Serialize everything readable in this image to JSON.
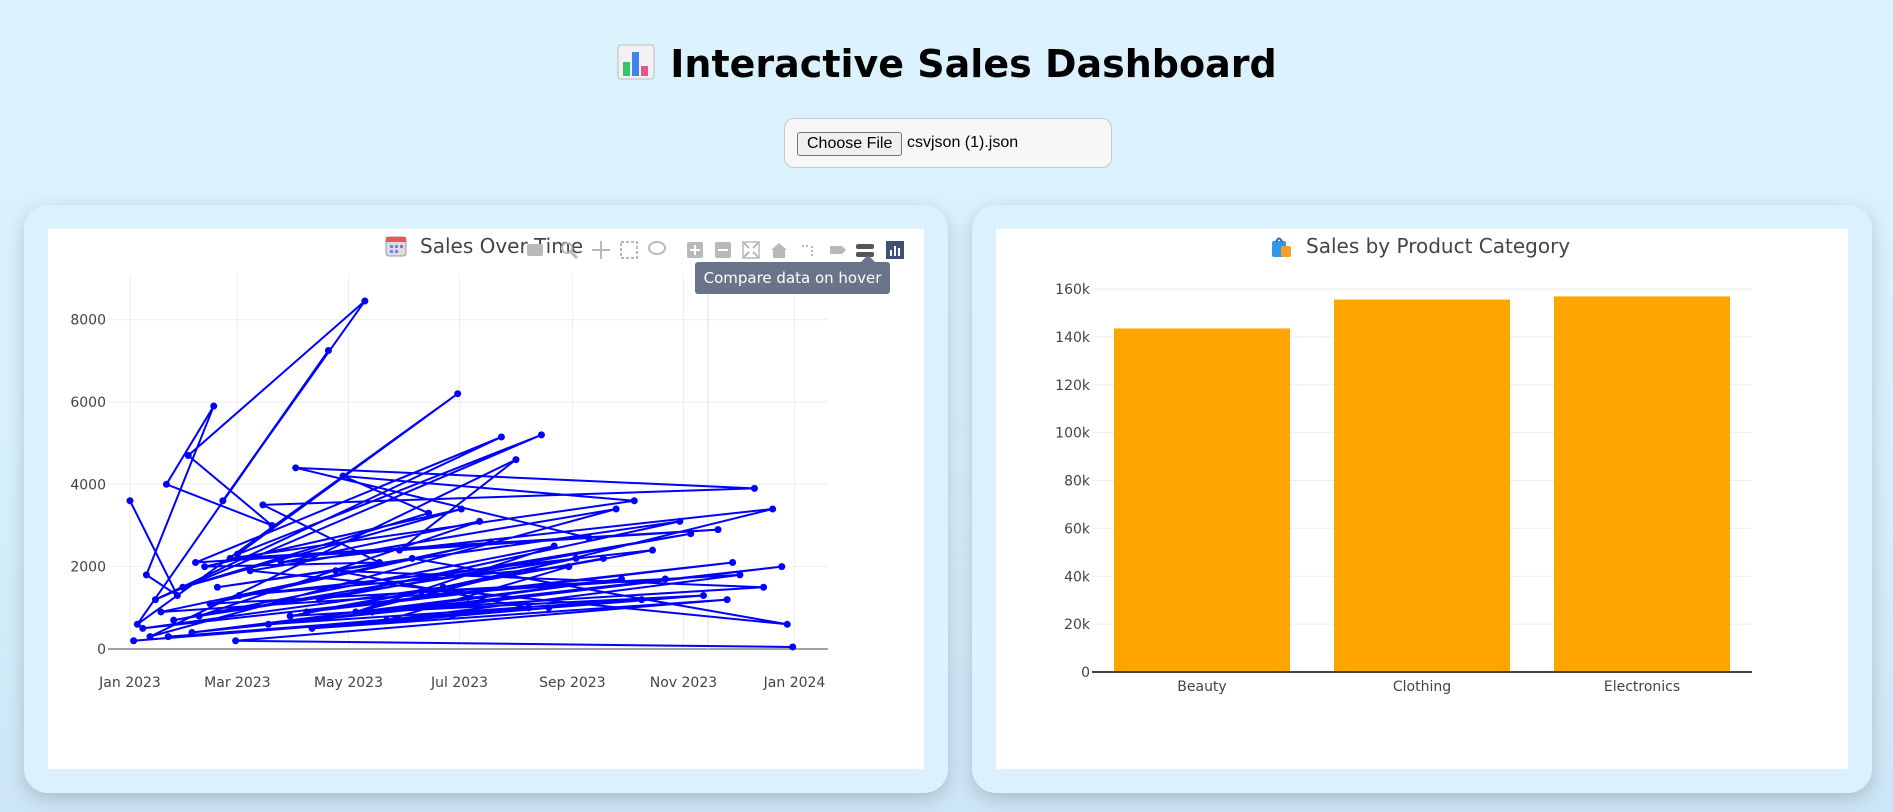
{
  "header": {
    "icon": "bar-chart-emoji-icon",
    "title": "Interactive Sales Dashboard"
  },
  "file_input": {
    "button_label": "Choose File",
    "file_name": "csvjson (1).json"
  },
  "toolbar": {
    "icons": [
      "camera-icon",
      "zoom-icon",
      "pan-icon",
      "box-select-icon",
      "lasso-select-icon",
      "zoom-in-icon",
      "zoom-out-icon",
      "autoscale-icon",
      "reset-axes-icon",
      "spike-lines-icon",
      "hover-closest-icon",
      "hover-compare-icon",
      "plotly-logo-icon"
    ],
    "tooltip": "Compare data on hover"
  },
  "chart_data": [
    {
      "type": "line",
      "title": "Sales Over Time",
      "title_icon": "calendar-emoji-icon",
      "xlabel": "",
      "ylabel": "",
      "x_ticks": [
        "Jan 2023",
        "Mar 2023",
        "May 2023",
        "Jul 2023",
        "Sep 2023",
        "Nov 2023",
        "Jan 2024"
      ],
      "y_ticks": [
        "0",
        "2000",
        "4000",
        "6000",
        "8000"
      ],
      "ylim": [
        0,
        9000
      ],
      "xlim": [
        "2023-01-01",
        "2024-01-15"
      ],
      "grid": true,
      "color": "#0000ff",
      "series": [
        {
          "x": [
            "2023-01-01",
            "2023-01-27",
            "2023-01-10",
            "2023-02-16",
            "2023-01-21",
            "2023-03-20",
            "2023-02-02",
            "2023-05-10",
            "2023-02-21",
            "2023-04-20",
            "2023-01-05",
            "2023-06-30",
            "2023-03-01",
            "2023-08-15",
            "2023-01-15",
            "2023-07-24",
            "2023-02-06",
            "2023-09-10",
            "2023-04-02",
            "2023-12-10",
            "2023-03-15",
            "2023-05-18",
            "2023-02-11",
            "2023-07-02",
            "2023-01-30",
            "2023-06-14",
            "2023-04-28",
            "2023-10-05",
            "2023-02-25",
            "2023-11-20",
            "2023-05-29",
            "2023-08-01",
            "2023-01-12",
            "2023-09-25",
            "2023-03-08",
            "2023-12-28",
            "2023-06-05",
            "2023-02-18",
            "2023-10-30",
            "2023-04-15",
            "2023-11-05",
            "2023-01-25",
            "2023-08-22",
            "2023-05-05",
            "2023-12-20",
            "2023-03-25",
            "2023-07-12",
            "2023-02-08",
            "2023-09-03",
            "2023-06-22",
            "2023-01-08",
            "2023-11-28",
            "2023-04-08",
            "2023-10-15",
            "2023-03-02",
            "2023-08-30",
            "2023-05-22",
            "2023-12-02",
            "2023-02-14",
            "2023-07-18",
            "2023-01-18",
            "2023-10-22",
            "2023-06-10",
            "2023-09-18",
            "2023-03-30",
            "2023-12-15",
            "2023-04-24",
            "2023-08-08",
            "2023-01-03",
            "2023-11-12",
            "2023-05-14",
            "2023-09-28",
            "2023-02-04",
            "2023-07-06",
            "2023-12-25",
            "2023-03-18",
            "2023-10-09",
            "2023-06-27",
            "2023-01-22",
            "2023-08-19",
            "2023-04-11",
            "2023-11-25",
            "2023-02-28",
            "2023-12-31"
          ],
          "y": [
            3600,
            1300,
            1800,
            5900,
            4000,
            3000,
            4700,
            8450,
            3600,
            7250,
            600,
            6200,
            2300,
            5200,
            1200,
            5150,
            2100,
            2700,
            4400,
            3900,
            3500,
            2100,
            2000,
            3400,
            1500,
            3300,
            4200,
            3600,
            2200,
            2900,
            2400,
            4600,
            300,
            3400,
            1900,
            600,
            2200,
            1500,
            3100,
            1200,
            2800,
            700,
            2500,
            900,
            3400,
            2100,
            3100,
            800,
            2200,
            1500,
            500,
            2100,
            900,
            2400,
            1300,
            2000,
            700,
            1800,
            1100,
            2600,
            900,
            1700,
            1400,
            2200,
            800,
            1500,
            1900,
            1000,
            200,
            1300,
            900,
            1700,
            400,
            1100,
            2000,
            600,
            1200,
            800,
            300,
            1000,
            500,
            1200,
            200,
            50
          ]
        }
      ]
    },
    {
      "type": "bar",
      "title": "Sales by Product Category",
      "title_icon": "shopping-bags-emoji-icon",
      "categories": [
        "Beauty",
        "Clothing",
        "Electronics"
      ],
      "values": [
        143515,
        155580,
        156905
      ],
      "y_ticks": [
        "0",
        "20k",
        "40k",
        "60k",
        "80k",
        "100k",
        "120k",
        "140k",
        "160k"
      ],
      "ylim": [
        0,
        160000
      ],
      "xlabel": "",
      "ylabel": "",
      "color": "#ffa500",
      "grid": true
    }
  ]
}
